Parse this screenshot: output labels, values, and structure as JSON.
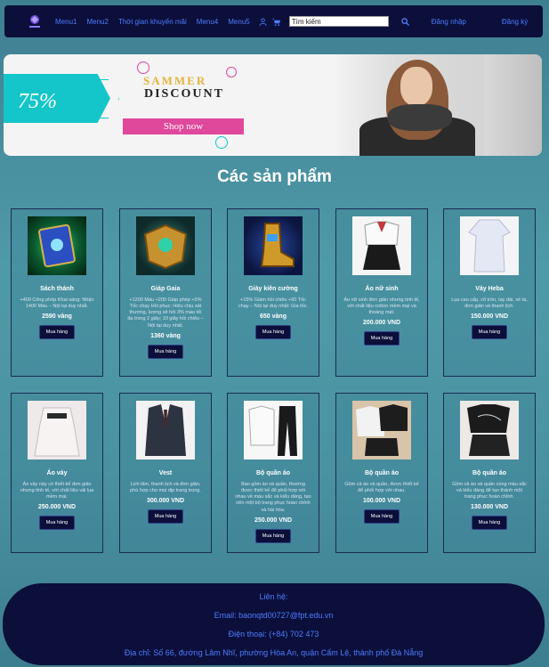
{
  "nav": {
    "menu1": "Menu1",
    "menu2": "Menu2",
    "promo": "Thời gian khuyến mãi",
    "menu4": "Menu4",
    "menu5": "Menu5",
    "search_placeholder": "Tìm kiếm",
    "login": "Đăng nhập",
    "signup": "Đăng ký",
    "icons": [
      "user-icon",
      "cart-icon",
      "search-icon"
    ]
  },
  "banner": {
    "percent": "75%",
    "title_top": "SAMMER",
    "title_bottom": "DISCOUNT",
    "cta": "Shop now"
  },
  "section_title": "Các sản phẩm",
  "products": [
    {
      "name": "Sách thánh",
      "desc": "+400 Công phép Khai sáng: Nhận 1400 Máu – Nội tại duy nhất.",
      "price": "2590 vàng",
      "buy": "Mua hàng"
    },
    {
      "name": "Giáp Gaia",
      "desc": "+1200 Máu +200 Giáp phép +5% Tốc chạy Hồi phục: Hiệu chịu sát thương, lượng sẽ hồi 3% máu tối đa trong 2 giây; 10 giây hồi chiêu – Nội tại duy nhất.",
      "price": "1360 vàng",
      "buy": "Mua hàng"
    },
    {
      "name": "Giày kiên cường",
      "desc": "+15% Giảm hồi chiêu +60 Tốc chạy – Nội tại duy nhất: Gia tốc.",
      "price": "650 vàng",
      "buy": "Mua hàng"
    },
    {
      "name": "Áo nữ sinh",
      "desc": "Áo nữ sinh đơn giản nhưng tinh tế, với chất liệu cotton mềm mại và thoáng mát.",
      "price": "200.000 VND",
      "buy": "Mua hàng"
    },
    {
      "name": "Váy Heba",
      "desc": "Lụa cao cấp, cổ tròn, tay dài, xẻ tà, đơn giản và thanh lịch.",
      "price": "150.000 VND",
      "buy": "Mua hàng"
    },
    {
      "name": "Áo váy",
      "desc": "Áo váy này có thiết kế đơn giản nhưng tinh tế, với chất liệu vải lụa mềm mại.",
      "price": "250.000 VND",
      "buy": "Mua hàng"
    },
    {
      "name": "Vest",
      "desc": "Lịch lãm, thanh lịch và đơn giản, phù hợp cho mọi dịp trang trọng.",
      "price": "300.000 VND",
      "buy": "Mua hàng"
    },
    {
      "name": "Bộ quần áo",
      "desc": "Bao gồm áo và quần, thường được thiết kế để phối hợp với nhau về màu sắc và kiểu dáng, tạo nên một bộ trang phục hoàn chỉnh và hài hòa.",
      "price": "250.000 VND",
      "buy": "Mua hàng"
    },
    {
      "name": "Bộ quần áo",
      "desc": "Gồm cả áo và quần, được thiết kế để phối hợp với nhau.",
      "price": "100.000 VND",
      "buy": "Mua hàng"
    },
    {
      "name": "Bộ quần áo",
      "desc": "Gồm cả áo và quần cùng màu sắc và kiểu dáng để tạo thành một trang phục hoàn chỉnh.",
      "price": "130.000 VND",
      "buy": "Mua hàng"
    }
  ],
  "footer": {
    "contact": "Liên hệ:",
    "email": "Email: baonqtd00727@fpt.edu.vn",
    "phone": "Điện thoại: (+84) 702 473",
    "address": "Địa chỉ: Số 66, đường Lâm Nhĩ, phường Hòa An, quận Cẩm Lệ, thành phố Đà Nẵng"
  }
}
